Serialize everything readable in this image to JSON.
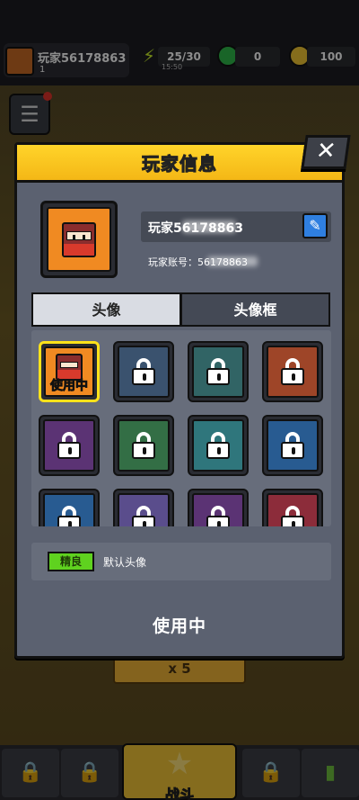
{
  "hud": {
    "player_name": "玩家56178863",
    "player_level": "1",
    "energy": "25/30",
    "energy_timer": "15:50",
    "gems": "0",
    "coins": "100"
  },
  "background": {
    "reward_button": "x 5",
    "battle_label": "战斗"
  },
  "dialog": {
    "title": "玩家信息",
    "close_label": "✕",
    "name_prefix": "玩家56178863",
    "account_label": "玩家账号：56178863",
    "tabs": [
      "头像",
      "头像框"
    ],
    "selected_badge": "使用中",
    "avatars": [
      {
        "id": "a1",
        "color": "#f08a22",
        "selected": true,
        "locked": false
      },
      {
        "id": "a2",
        "color": "#4a6f9a",
        "selected": false,
        "locked": true
      },
      {
        "id": "a3",
        "color": "#3d8a8c",
        "selected": false,
        "locked": true
      },
      {
        "id": "a4",
        "color": "#e35b2e",
        "selected": false,
        "locked": true
      },
      {
        "id": "a5",
        "color": "#7d3fa4",
        "selected": false,
        "locked": true
      },
      {
        "id": "a6",
        "color": "#3f9a5b",
        "selected": false,
        "locked": true
      },
      {
        "id": "a7",
        "color": "#39a7b0",
        "selected": false,
        "locked": true
      },
      {
        "id": "a8",
        "color": "#2f7dcf",
        "selected": false,
        "locked": true
      },
      {
        "id": "a9",
        "color": "#2f7dcf",
        "selected": false,
        "locked": true
      },
      {
        "id": "a10",
        "color": "#7c68c8",
        "selected": false,
        "locked": true
      },
      {
        "id": "a11",
        "color": "#7d3fa4",
        "selected": false,
        "locked": true
      },
      {
        "id": "a12",
        "color": "#c8354a",
        "selected": false,
        "locked": true
      }
    ],
    "rarity": "精良",
    "rarity_color": "#5fd21f",
    "avatar_desc": "默认头像",
    "status": "使用中"
  }
}
